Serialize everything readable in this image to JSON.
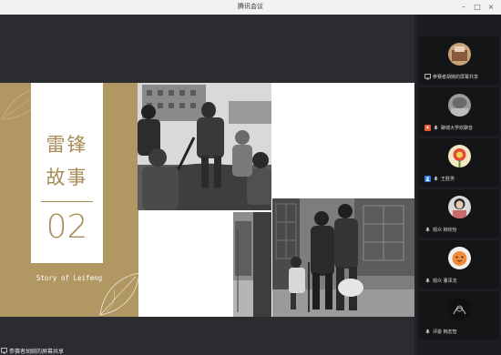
{
  "window": {
    "title": "腾讯会议"
  },
  "slide": {
    "title_line1": "雷锋",
    "title_line2": "故事",
    "number": "02",
    "subtitle_en": "Story of Leifeng",
    "accent_color": "#b19762"
  },
  "participants": [
    {
      "name": "参赛者胡婉的屏幕共享",
      "status_icon": "screen-share-icon",
      "avatar": "photo-brown"
    },
    {
      "name": "聊城大学欢聊音",
      "status_icon": "mic-muted-icon",
      "avatar": "photo-gray"
    },
    {
      "name": "王胜男",
      "status_icon": "user-icon",
      "avatar": "cartoon-flower"
    },
    {
      "name": "观众 柳欣怡",
      "status_icon": "mic-icon",
      "avatar": "photo-girl"
    },
    {
      "name": "观众 董泽龙",
      "status_icon": "mic-icon",
      "avatar": "cartoon-orange"
    },
    {
      "name": "评委 韩宏智",
      "status_icon": "mic-icon",
      "avatar": "dark-sketch"
    }
  ],
  "bottom_bar": {
    "label": "参赛者胡婉的屏幕共享",
    "icon": "screen-share-icon"
  }
}
